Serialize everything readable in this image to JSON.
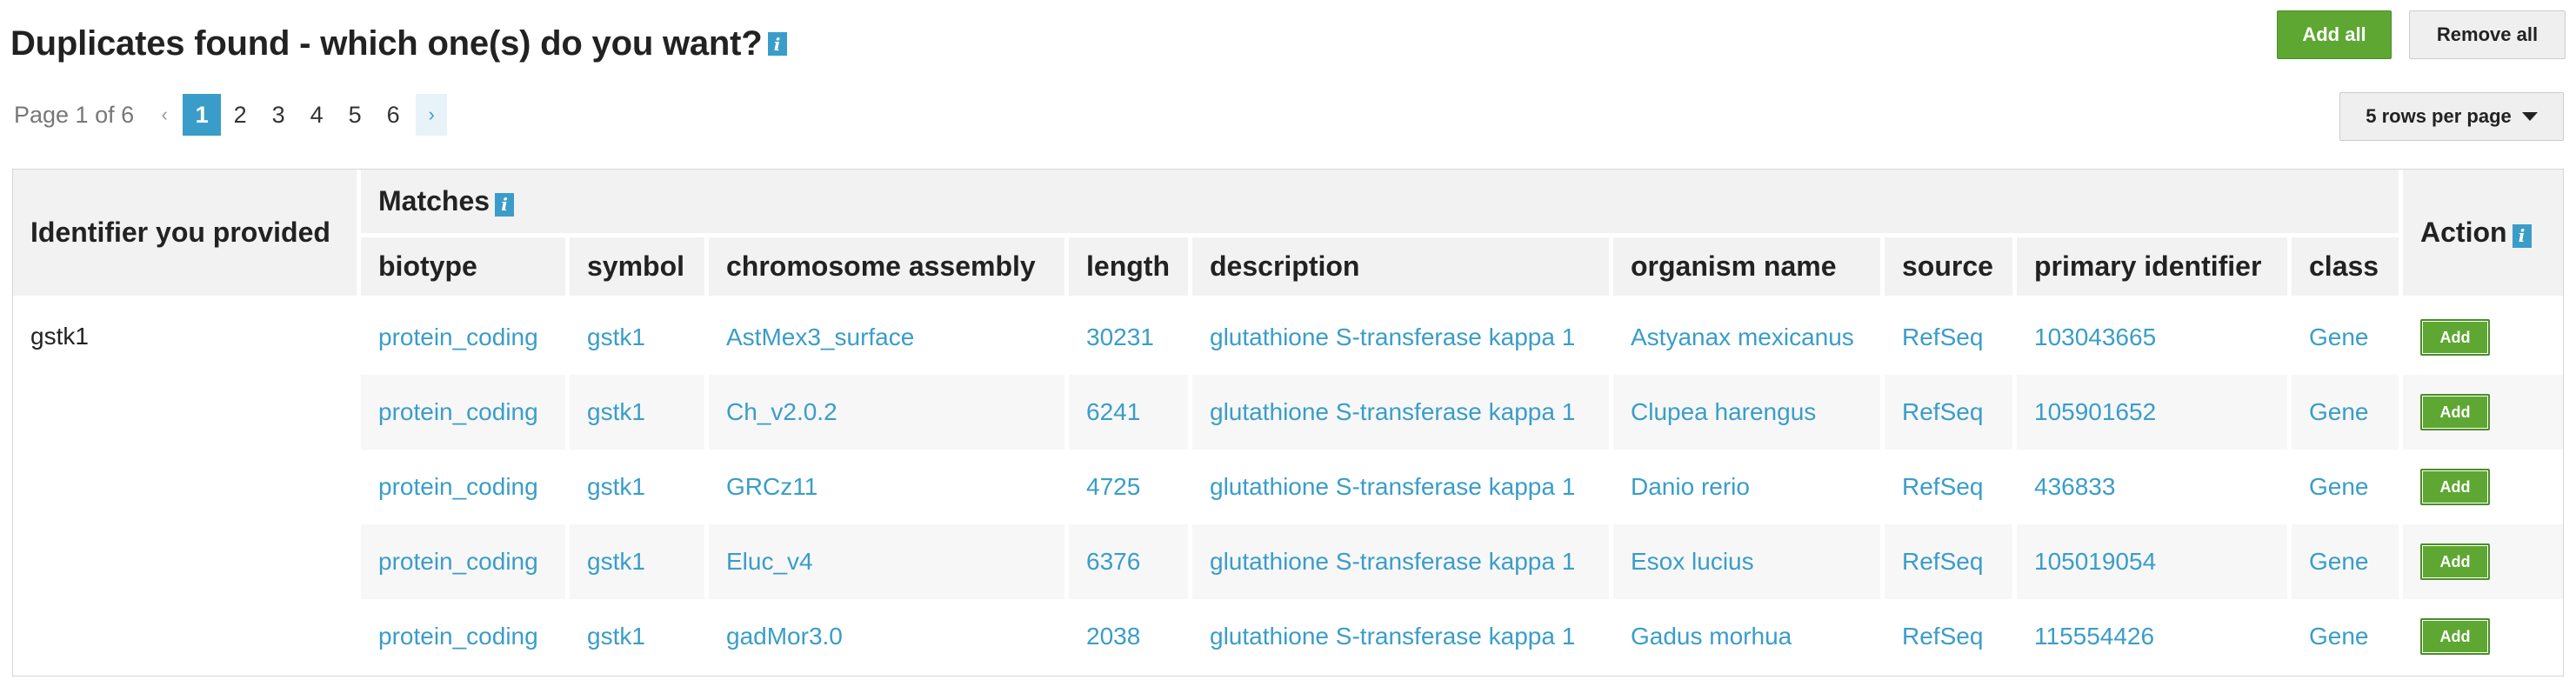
{
  "header": {
    "title": "Duplicates found - which one(s) do you want?",
    "info_icon": "i",
    "add_all_label": "Add all",
    "remove_all_label": "Remove all"
  },
  "pager": {
    "page_info": "Page 1 of 6",
    "prev": "‹",
    "next": "›",
    "pages": [
      "1",
      "2",
      "3",
      "4",
      "5",
      "6"
    ],
    "active_page": "1",
    "rows_per_page_label": "5 rows per page"
  },
  "table": {
    "identifier_header": "Identifier you provided",
    "matches_header": "Matches",
    "action_header": "Action",
    "columns": [
      "biotype",
      "symbol",
      "chromosome assembly",
      "length",
      "description",
      "organism name",
      "source",
      "primary identifier",
      "class"
    ],
    "identifier_value": "gstk1",
    "add_label": "Add",
    "rows": [
      {
        "biotype": "protein_coding",
        "symbol": "gstk1",
        "assembly": "AstMex3_surface",
        "length": "30231",
        "description": "glutathione S-transferase kappa 1",
        "organism": "Astyanax mexicanus",
        "source": "RefSeq",
        "primary_id": "103043665",
        "class": "Gene"
      },
      {
        "biotype": "protein_coding",
        "symbol": "gstk1",
        "assembly": "Ch_v2.0.2",
        "length": "6241",
        "description": "glutathione S-transferase kappa 1",
        "organism": "Clupea harengus",
        "source": "RefSeq",
        "primary_id": "105901652",
        "class": "Gene"
      },
      {
        "biotype": "protein_coding",
        "symbol": "gstk1",
        "assembly": "GRCz11",
        "length": "4725",
        "description": "glutathione S-transferase kappa 1",
        "organism": "Danio rerio",
        "source": "RefSeq",
        "primary_id": "436833",
        "class": "Gene"
      },
      {
        "biotype": "protein_coding",
        "symbol": "gstk1",
        "assembly": "Eluc_v4",
        "length": "6376",
        "description": "glutathione S-transferase kappa 1",
        "organism": "Esox lucius",
        "source": "RefSeq",
        "primary_id": "105019054",
        "class": "Gene"
      },
      {
        "biotype": "protein_coding",
        "symbol": "gstk1",
        "assembly": "gadMor3.0",
        "length": "2038",
        "description": "glutathione S-transferase kappa 1",
        "organism": "Gadus morhua",
        "source": "RefSeq",
        "primary_id": "115554426",
        "class": "Gene"
      }
    ]
  },
  "colors": {
    "accent": "#3a9dc9",
    "add_button": "#5ea733"
  }
}
